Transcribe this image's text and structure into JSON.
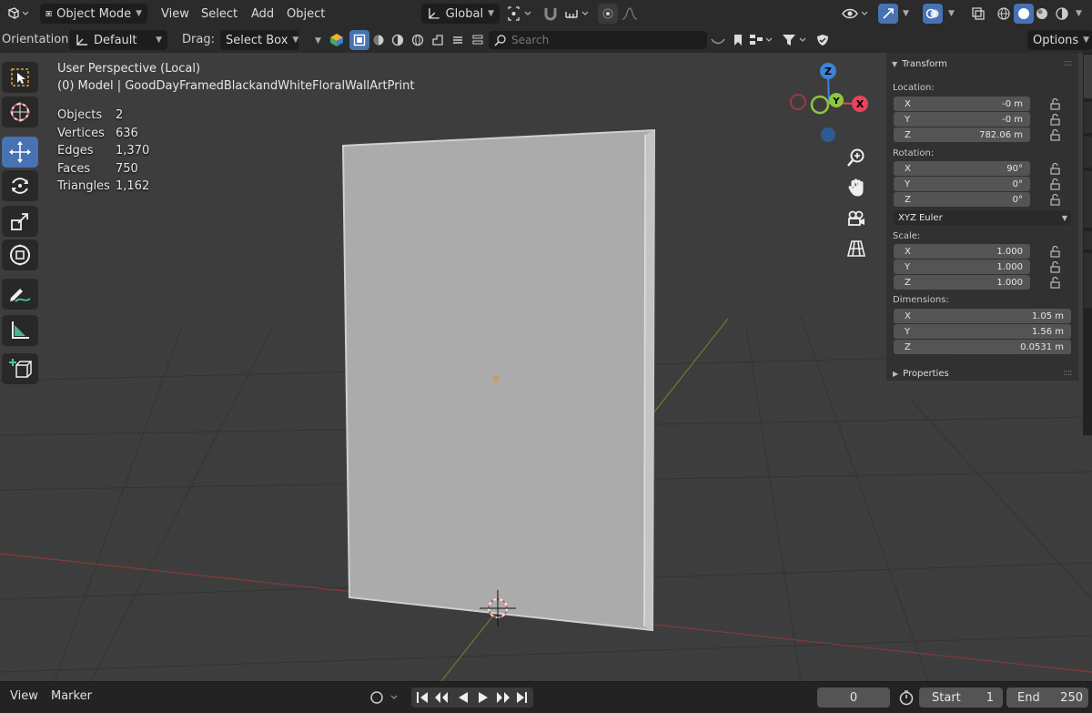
{
  "header": {
    "mode": "Object Mode",
    "menus": [
      "View",
      "Select",
      "Add",
      "Object"
    ],
    "transform_space": "Global"
  },
  "toolbar2": {
    "orientation_label": "Orientation:",
    "orientation_value": "Default",
    "drag_label": "Drag:",
    "drag_value": "Select Box",
    "search_placeholder": "Search",
    "options_label": "Options"
  },
  "viewport": {
    "view_name": "User Perspective (Local)",
    "object_info": "(0) Model | GoodDayFramedBlackandWhiteFloralWallArtPrint",
    "stats": [
      {
        "label": "Objects",
        "value": "2"
      },
      {
        "label": "Vertices",
        "value": "636"
      },
      {
        "label": "Edges",
        "value": "1,370"
      },
      {
        "label": "Faces",
        "value": "750"
      },
      {
        "label": "Triangles",
        "value": "1,162"
      }
    ],
    "gizmo": {
      "z": "Z",
      "y": "Y",
      "x": "X"
    }
  },
  "tools": [
    "select-box-tool",
    "cursor-tool",
    "move-tool",
    "rotate-tool",
    "scale-tool",
    "transform-tool",
    "annotate-tool",
    "measure-tool",
    "add-cube-tool"
  ],
  "nav_buttons": [
    "zoom-icon",
    "hand-pan-icon",
    "camera-icon",
    "grid-ortho-icon"
  ],
  "properties": {
    "transform_title": "Transform",
    "location_label": "Location:",
    "location": [
      {
        "axis": "X",
        "value": "-0 m"
      },
      {
        "axis": "Y",
        "value": "-0 m"
      },
      {
        "axis": "Z",
        "value": "782.06 m"
      }
    ],
    "rotation_label": "Rotation:",
    "rotation": [
      {
        "axis": "X",
        "value": "90°"
      },
      {
        "axis": "Y",
        "value": "0°"
      },
      {
        "axis": "Z",
        "value": "0°"
      }
    ],
    "rotation_mode": "XYZ Euler",
    "scale_label": "Scale:",
    "scale": [
      {
        "axis": "X",
        "value": "1.000"
      },
      {
        "axis": "Y",
        "value": "1.000"
      },
      {
        "axis": "Z",
        "value": "1.000"
      }
    ],
    "dimensions_label": "Dimensions:",
    "dimensions": [
      {
        "axis": "X",
        "value": "1.05 m"
      },
      {
        "axis": "Y",
        "value": "1.56 m"
      },
      {
        "axis": "Z",
        "value": "0.0531 m"
      }
    ],
    "properties_title": "Properties"
  },
  "timeline": {
    "view_label": "View",
    "marker_label": "Marker",
    "current_frame": "0",
    "start_label": "Start",
    "start_value": "1",
    "end_label": "End",
    "end_value": "250"
  },
  "colors": {
    "accent": "#4772b3",
    "axis_x": "#e8435b",
    "axis_y": "#8ec63f",
    "axis_z": "#3d83d9"
  }
}
